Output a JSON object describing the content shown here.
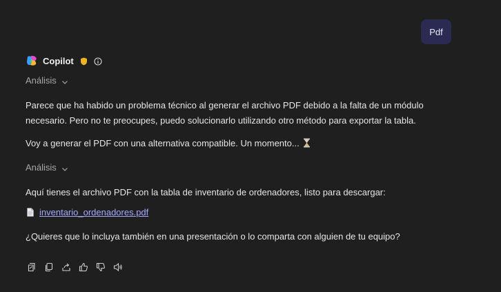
{
  "user_message": {
    "text": "Pdf"
  },
  "assistant": {
    "name": "Copilot",
    "analysis_label": "Análisis",
    "paragraph_1": "Parece que ha habido un problema técnico al generar el archivo PDF debido a la falta de un módulo necesario. Pero no te preocupes, puedo solucionarlo utilizando otro método para exportar la tabla.",
    "paragraph_2": "Voy a generar el PDF con una alternativa compatible. Un momento...",
    "analysis_label_2": "Análisis",
    "paragraph_3": "Aquí tienes el archivo PDF con la tabla de inventario de ordenadores, listo para descargar:",
    "file_link": "inventario_ordenadores.pdf",
    "paragraph_4": "¿Quieres que lo incluya también en una presentación o lo comparta con alguien de tu equipo?"
  },
  "icons": {
    "logo": "copilot-logo-icon",
    "shield": "shield-icon",
    "info": "info-icon",
    "chevron": "chevron-down-icon",
    "hourglass": "hourglass-icon",
    "file": "file-icon",
    "actions": [
      "pages-icon",
      "copy-icon",
      "share-icon",
      "thumbs-up-icon",
      "thumbs-down-icon",
      "speaker-icon"
    ]
  },
  "colors": {
    "background": "#1f1f1f",
    "user_bubble": "#2b2a52",
    "link": "#a7a9ff",
    "muted": "#a8a8a8",
    "shield": "#f0b323"
  }
}
